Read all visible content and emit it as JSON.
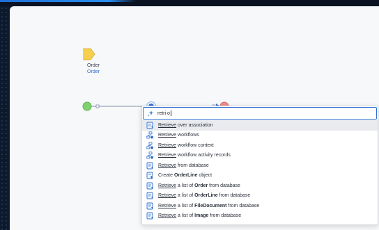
{
  "parameter": {
    "name": "Order",
    "type": "Order"
  },
  "colors": {
    "start": "#7ed26e",
    "end": "#f08c8c",
    "active": "#2f6fd1",
    "parameter": "#f7cf4f"
  },
  "search": {
    "query": "retri o"
  },
  "results": [
    {
      "icon": "retrieve-icon",
      "match": "Retrieve",
      "rest": " over association",
      "selected": true
    },
    {
      "icon": "workflow-icon",
      "match": "Retrieve",
      "rest": " workflows"
    },
    {
      "icon": "workflow-icon",
      "match": "Retrieve",
      "rest": " workflow context"
    },
    {
      "icon": "workflow-icon",
      "match": "Retrieve",
      "rest": " workflow activity records"
    },
    {
      "icon": "retrieve-icon",
      "match": "Retrieve",
      "rest": " from database"
    },
    {
      "icon": "create-object-icon",
      "pre": "Create ",
      "bold": "OrderLine",
      "post": " object"
    },
    {
      "icon": "retrieve-icon",
      "match": "Retrieve",
      "rest": " a list of ",
      "bold": "Order",
      "post": " from database"
    },
    {
      "icon": "retrieve-icon",
      "match": "Retrieve",
      "rest": " a list of ",
      "bold": "OrderLine",
      "post": " from database"
    },
    {
      "icon": "retrieve-icon",
      "match": "Retrieve",
      "rest": " a list of ",
      "bold": "FileDocument",
      "post": " from database"
    },
    {
      "icon": "retrieve-icon",
      "match": "Retrieve",
      "rest": " a list of ",
      "bold": "Image",
      "post": " from database"
    }
  ]
}
